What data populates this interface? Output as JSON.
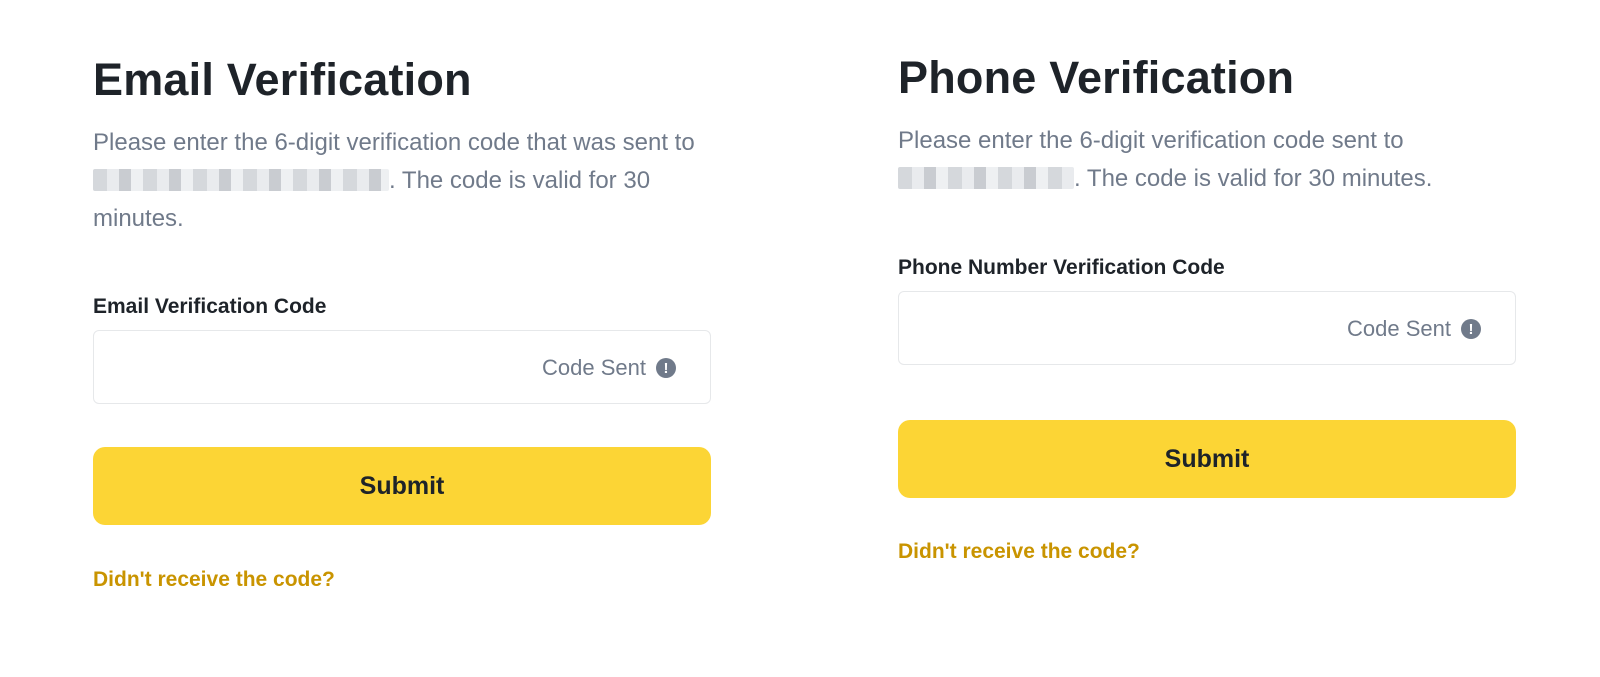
{
  "email": {
    "title": "Email Verification",
    "desc_before": "Please enter the 6-digit verification code that was sent to",
    "desc_after": ". The code is valid for 30 minutes.",
    "field_label": "Email Verification Code",
    "input_value": "",
    "code_sent": "Code Sent",
    "submit_label": "Submit",
    "resend_link": "Didn't receive the code?"
  },
  "phone": {
    "title": "Phone Verification",
    "desc_before": "Please enter the 6-digit verification code sent to",
    "desc_after": ". The code is valid for 30 minutes.",
    "field_label": "Phone Number Verification Code",
    "input_value": "",
    "code_sent": "Code Sent",
    "submit_label": "Submit",
    "resend_link": "Didn't receive the code?"
  },
  "colors": {
    "accent": "#fcd535",
    "link": "#c99400",
    "muted_text": "#707a8a",
    "primary_text": "#1e2329"
  },
  "icons": {
    "code_sent_icon": "exclamation-circle-icon",
    "redaction": "blurred-contact-placeholder"
  }
}
